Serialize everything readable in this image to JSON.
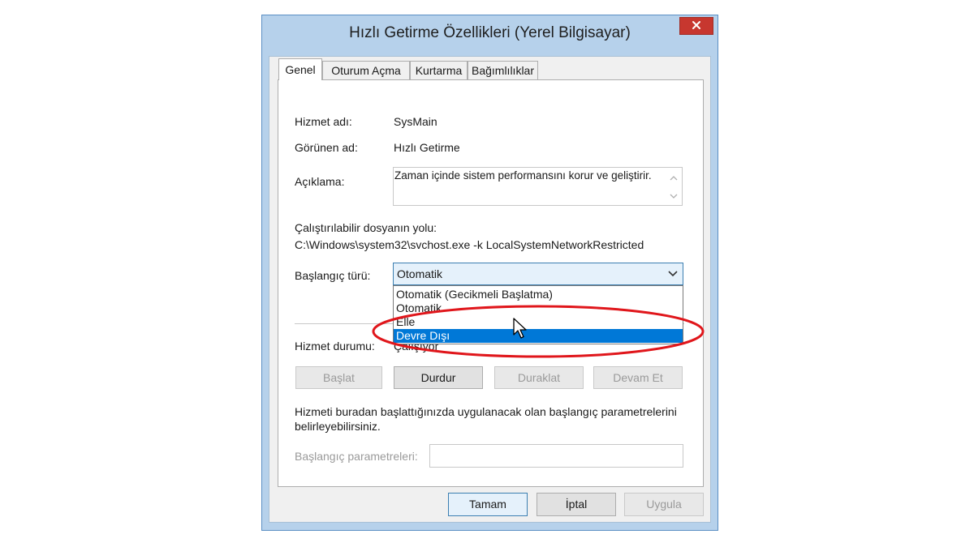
{
  "window": {
    "title": "Hızlı Getirme Özellikleri (Yerel Bilgisayar)",
    "close_glyph": "✕"
  },
  "tabs": [
    "Genel",
    "Oturum Açma",
    "Kurtarma",
    "Bağımlılıklar"
  ],
  "general": {
    "service_name_label": "Hizmet adı:",
    "service_name_value": "SysMain",
    "display_name_label": "Görünen ad:",
    "display_name_value": "Hızlı Getirme",
    "description_label": "Açıklama:",
    "description_value": "Zaman içinde sistem performansını korur ve geliştirir.",
    "exe_path_label": "Çalıştırılabilir dosyanın yolu:",
    "exe_path_value": "C:\\Windows\\system32\\svchost.exe -k LocalSystemNetworkRestricted",
    "startup_type_label": "Başlangıç türü:",
    "startup_type_value": "Otomatik",
    "startup_options": [
      "Otomatik (Gecikmeli Başlatma)",
      "Otomatik",
      "Elle",
      "Devre Dışı"
    ],
    "highlighted_option": "Devre Dışı",
    "service_status_label": "Hizmet durumu:",
    "service_status_value": "Çalışıyor",
    "buttons": {
      "start": "Başlat",
      "stop": "Durdur",
      "pause": "Duraklat",
      "resume": "Devam Et"
    },
    "params_help": "Hizmeti buradan başlattığınızda uygulanacak olan başlangıç parametrelerini belirleyebilirsiniz.",
    "params_label": "Başlangıç parametreleri:"
  },
  "footer": {
    "ok": "Tamam",
    "cancel": "İptal",
    "apply": "Uygula"
  },
  "colors": {
    "title_bar": "#b6d1eb",
    "close": "#c7372f",
    "highlight": "#0078d7",
    "annotation": "#e0161b"
  },
  "icons": {
    "dropdown": "chevron-down-icon",
    "cursor": "mouse-pointer-icon",
    "scroll_up": "scroll-up-icon",
    "scroll_down": "scroll-down-icon"
  }
}
